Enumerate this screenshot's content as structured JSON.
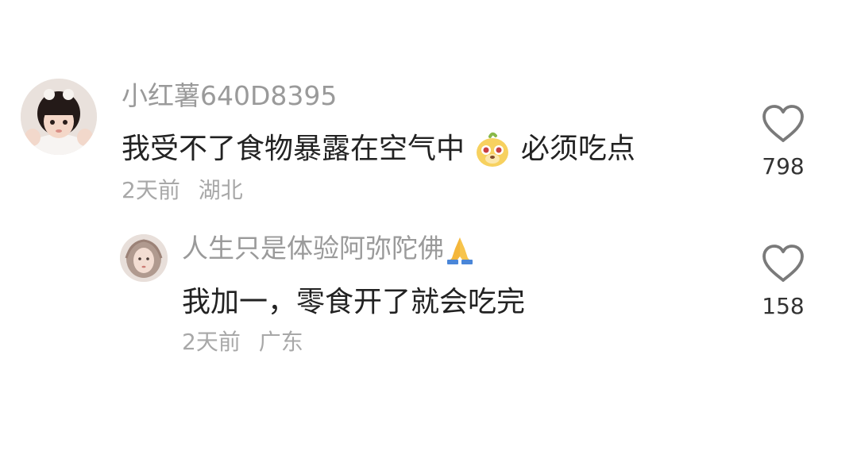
{
  "comments": [
    {
      "username": "小红薯640D8395",
      "text_before_emoji": "我受不了食物暴露在空气中",
      "emoji": "cute-dog-face-sticker",
      "text_after_emoji": "必须吃点",
      "time": "2天前",
      "location": "湖北",
      "likes": "798",
      "avatar_icon": "child-avatar-icon"
    },
    {
      "username": "人生只是体验阿弥陀佛",
      "username_emoji": "🙏",
      "text": "我加一，零食开了就会吃完",
      "time": "2天前",
      "location": "广东",
      "likes": "158",
      "avatar_icon": "girl-avatar-icon"
    }
  ],
  "colors": {
    "username": "#9a9a9a",
    "text": "#222222",
    "meta": "#a8a8a8",
    "heart": "#7a7a7a"
  }
}
